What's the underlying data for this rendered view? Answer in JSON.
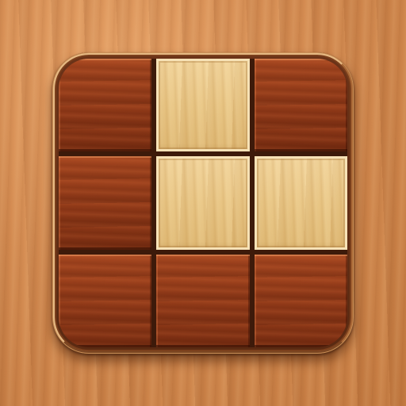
{
  "app": {
    "icon_name": "wooden-block-puzzle-app-icon"
  },
  "board": {
    "rows": 3,
    "cols": 3,
    "cells": [
      [
        "dark",
        "light",
        "dark"
      ],
      [
        "dark",
        "light",
        "light"
      ],
      [
        "dark",
        "dark",
        "dark"
      ]
    ]
  },
  "colors": {
    "background_wood": "#d38a50",
    "dark_tile": "#8c3717",
    "light_tile": "#e9c685",
    "frame": "#5a2a12"
  }
}
